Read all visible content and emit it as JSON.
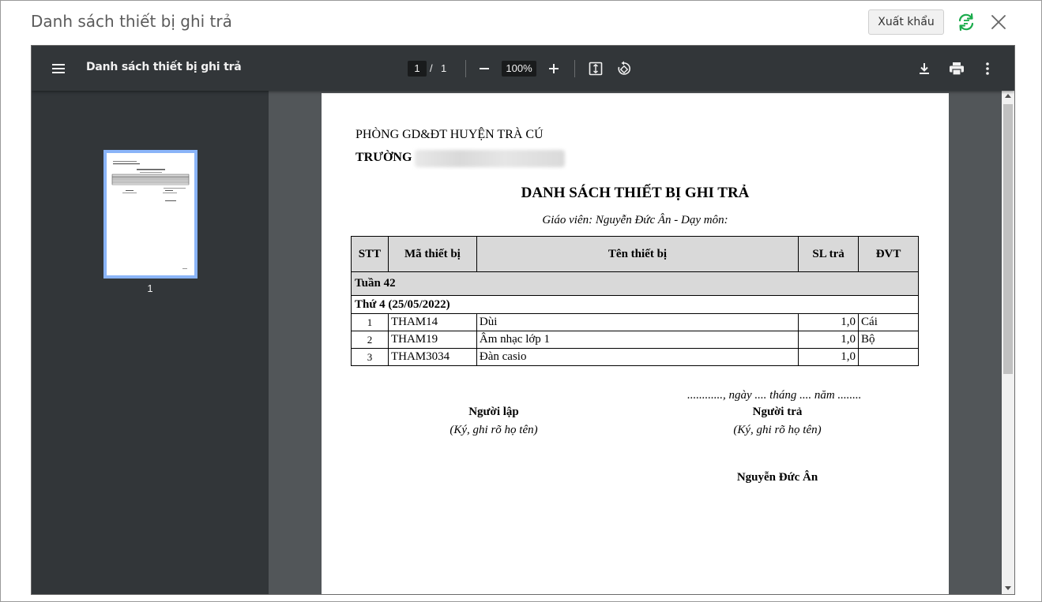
{
  "dialog": {
    "title": "Danh sách thiết bị ghi trả",
    "export_label": "Xuất khẩu"
  },
  "viewer": {
    "file_title": "Danh sách thiết bị ghi trả",
    "current_page": "1",
    "page_separator": "/",
    "total_pages": "1",
    "zoom": "100%",
    "thumbnail_label": "1"
  },
  "document": {
    "department": "PHÒNG GD&ĐT HUYỆN TRÀ CÚ",
    "school_prefix": "TRƯỜNG",
    "title": "DANH SÁCH THIẾT BỊ GHI TRẢ",
    "subtitle": "Giáo viên: Nguyễn Đức Ân - Dạy môn:",
    "headers": {
      "stt": "STT",
      "code": "Mã thiết bị",
      "name": "Tên thiết bị",
      "qty": "SL trả",
      "unit": "ĐVT"
    },
    "week": "Tuần 42",
    "day": "Thứ 4 (25/05/2022)",
    "rows": [
      {
        "stt": "1",
        "code": "THAM14",
        "name": "Dùi",
        "qty": "1,0",
        "unit": "Cái"
      },
      {
        "stt": "2",
        "code": "THAM19",
        "name": "Âm nhạc lớp 1",
        "qty": "1,0",
        "unit": "Bộ"
      },
      {
        "stt": "3",
        "code": "THAM3034",
        "name": "Đàn casio",
        "qty": "1,0",
        "unit": ""
      }
    ],
    "date_line": "............, ngày .... tháng .... năm ........",
    "creator_label": "Người lập",
    "creator_note": "(Ký, ghi rõ họ tên)",
    "returner_label": "Người trả",
    "returner_note": "(Ký, ghi rõ họ tên)",
    "signer_name": "Nguyễn Đức Ân"
  },
  "colors": {
    "toolbar_bg": "#323639",
    "viewer_bg": "#525659",
    "thumb_border": "#8ab4f8",
    "refresh_icon": "#1aab4b"
  },
  "icons": [
    "refresh-icon",
    "close-icon",
    "menu-icon",
    "minus-icon",
    "plus-icon",
    "fit-page-icon",
    "rotate-icon",
    "download-icon",
    "print-icon",
    "more-vert-icon"
  ]
}
